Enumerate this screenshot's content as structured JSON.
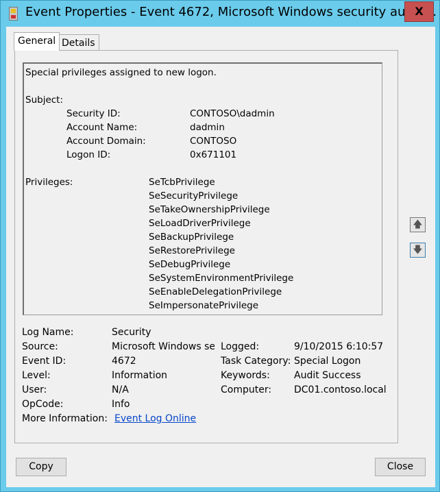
{
  "window": {
    "title": "Event Properties - Event 4672, Microsoft Windows security auditi...",
    "close_label": "X"
  },
  "tabs": [
    {
      "label": "General"
    },
    {
      "label": "Details"
    }
  ],
  "message": {
    "line1": "Special privileges assigned to new logon.",
    "subject_label": "Subject:",
    "subject": [
      {
        "k": "Security ID:",
        "v": "CONTOSO\\dadmin"
      },
      {
        "k": "Account Name:",
        "v": "dadmin"
      },
      {
        "k": "Account Domain:",
        "v": "CONTOSO"
      },
      {
        "k": "Logon ID:",
        "v": "0x671101"
      }
    ],
    "privileges_label": "Privileges:",
    "privileges": [
      "SeTcbPrivilege",
      "SeSecurityPrivilege",
      "SeTakeOwnershipPrivilege",
      "SeLoadDriverPrivilege",
      "SeBackupPrivilege",
      "SeRestorePrivilege",
      "SeDebugPrivilege",
      "SeSystemEnvironmentPrivilege",
      "SeEnableDelegationPrivilege",
      "SeImpersonatePrivilege"
    ]
  },
  "info": {
    "log_name_label": "Log Name:",
    "log_name": "Security",
    "source_label": "Source:",
    "source": "Microsoft Windows sec",
    "logged_label": "Logged:",
    "logged": "9/10/2015 6:10:57 PI",
    "event_id_label": "Event ID:",
    "event_id": "4672",
    "task_label": "Task Category:",
    "task": "Special Logon",
    "level_label": "Level:",
    "level": "Information",
    "keywords_label": "Keywords:",
    "keywords": "Audit Success",
    "user_label": "User:",
    "user": "N/A",
    "computer_label": "Computer:",
    "computer": "DC01.contoso.local",
    "opcode_label": "OpCode:",
    "opcode": "Info",
    "more_label": "More Information:",
    "more_link": "Event Log Online "
  },
  "nav": {
    "up": "🡅",
    "down": "🡇"
  },
  "buttons": {
    "copy": "Copy",
    "close": "Close"
  }
}
